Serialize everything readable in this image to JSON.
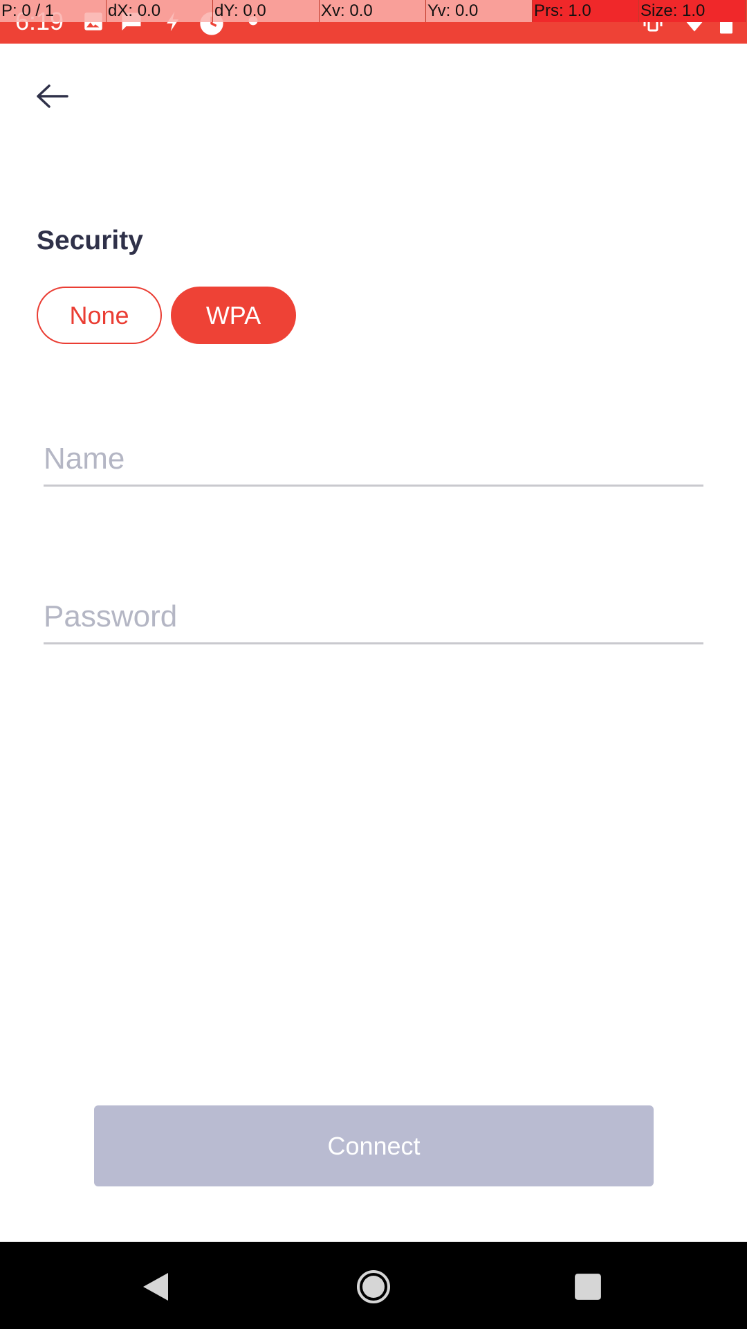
{
  "status_bar": {
    "time": "6:19",
    "left_icons": [
      "image-icon",
      "chat-icon",
      "bolt-icon",
      "sync-icon",
      "dot-icon"
    ],
    "right_icons": [
      "vibrate-icon",
      "wifi-icon",
      "battery-icon"
    ]
  },
  "overlay": {
    "cells": [
      "P: 0 / 1",
      "dX: 0.0",
      "dY: 0.0",
      "Xv: 0.0",
      "Yv: 0.0",
      "Prs: 1.0",
      "Size: 1.0"
    ]
  },
  "header": {
    "back_icon": "back-arrow-icon"
  },
  "security": {
    "title": "Security",
    "options": [
      "None",
      "WPA"
    ],
    "selected": "WPA"
  },
  "form": {
    "name_placeholder": "Name",
    "name_value": "",
    "password_placeholder": "Password",
    "password_value": ""
  },
  "actions": {
    "connect_label": "Connect"
  },
  "nav_bar": {
    "icons": [
      "nav-back-icon",
      "nav-home-icon",
      "nav-recents-icon"
    ]
  },
  "colors": {
    "accent": "#ee4236",
    "title_text": "#2f3149",
    "disabled_button": "#b9bbd1",
    "placeholder": "#b4b6c4"
  }
}
